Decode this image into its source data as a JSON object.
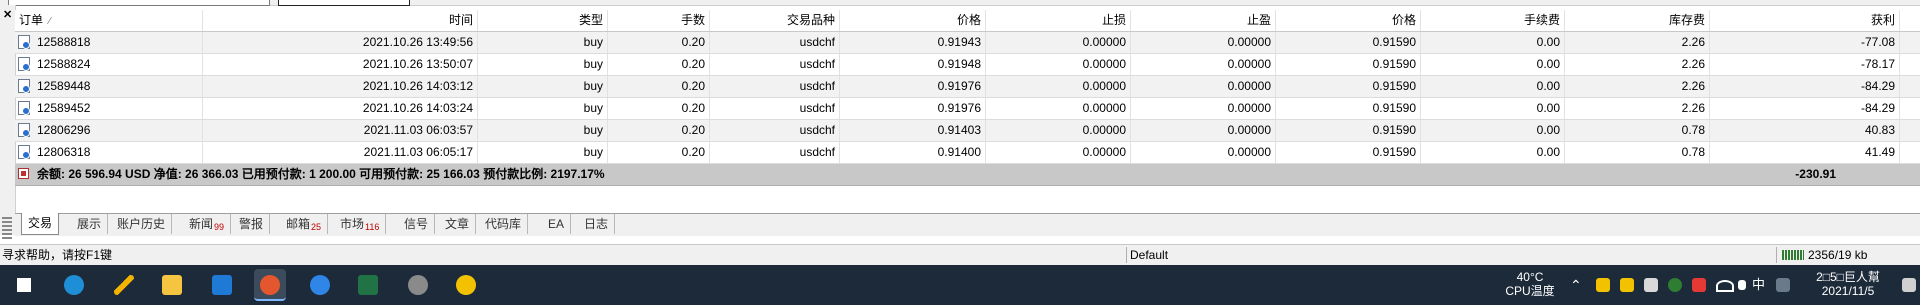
{
  "columns": [
    "订单",
    "时间",
    "类型",
    "手数",
    "交易品种",
    "价格",
    "止损",
    "止盈",
    "价格",
    "手续费",
    "库存费",
    "获利"
  ],
  "rows": [
    [
      "12588818",
      "2021.10.26 13:49:56",
      "buy",
      "0.20",
      "usdchf",
      "0.91943",
      "0.00000",
      "0.00000",
      "0.91590",
      "0.00",
      "2.26",
      "-77.08"
    ],
    [
      "12588824",
      "2021.10.26 13:50:07",
      "buy",
      "0.20",
      "usdchf",
      "0.91948",
      "0.00000",
      "0.00000",
      "0.91590",
      "0.00",
      "2.26",
      "-78.17"
    ],
    [
      "12589448",
      "2021.10.26 14:03:12",
      "buy",
      "0.20",
      "usdchf",
      "0.91976",
      "0.00000",
      "0.00000",
      "0.91590",
      "0.00",
      "2.26",
      "-84.29"
    ],
    [
      "12589452",
      "2021.10.26 14:03:24",
      "buy",
      "0.20",
      "usdchf",
      "0.91976",
      "0.00000",
      "0.00000",
      "0.91590",
      "0.00",
      "2.26",
      "-84.29"
    ],
    [
      "12806296",
      "2021.11.03 06:03:57",
      "buy",
      "0.20",
      "usdchf",
      "0.91403",
      "0.00000",
      "0.00000",
      "0.91590",
      "0.00",
      "0.78",
      "40.83"
    ],
    [
      "12806318",
      "2021.11.03 06:05:17",
      "buy",
      "0.20",
      "usdchf",
      "0.91400",
      "0.00000",
      "0.00000",
      "0.91590",
      "0.00",
      "0.78",
      "41.49"
    ]
  ],
  "balance_text": "余额: 26 596.94 USD  净值: 26 366.03  已用预付款: 1 200.00  可用预付款: 25 166.03  预付款比例: 2197.17%",
  "balance_total": "-230.91",
  "tabs": [
    {
      "label": "交易",
      "badge": ""
    },
    {
      "label": "展示",
      "badge": ""
    },
    {
      "label": "账户历史",
      "badge": ""
    },
    {
      "label": "新闻",
      "badge": "99"
    },
    {
      "label": "警报",
      "badge": ""
    },
    {
      "label": "邮箱",
      "badge": "25"
    },
    {
      "label": "市场",
      "badge": "116"
    },
    {
      "label": "信号",
      "badge": ""
    },
    {
      "label": "文章",
      "badge": ""
    },
    {
      "label": "代码库",
      "badge": ""
    },
    {
      "label": "EA",
      "badge": ""
    },
    {
      "label": "日志",
      "badge": ""
    }
  ],
  "status": {
    "help": "寻求帮助，请按F1键",
    "profile": "Default",
    "traffic": "2356/19 kb"
  },
  "taskbar": {
    "temp": "40°C",
    "temp_label": "CPU温度",
    "ime": "中",
    "date": "2021/11/5",
    "time_fragment": "2□5□巨人幫",
    "apps": [
      "windows-start",
      "edge",
      "pen-app",
      "file-explorer",
      "app-z",
      "mail-app",
      "browser-app",
      "excel",
      "photo-app",
      "chat-app"
    ]
  }
}
